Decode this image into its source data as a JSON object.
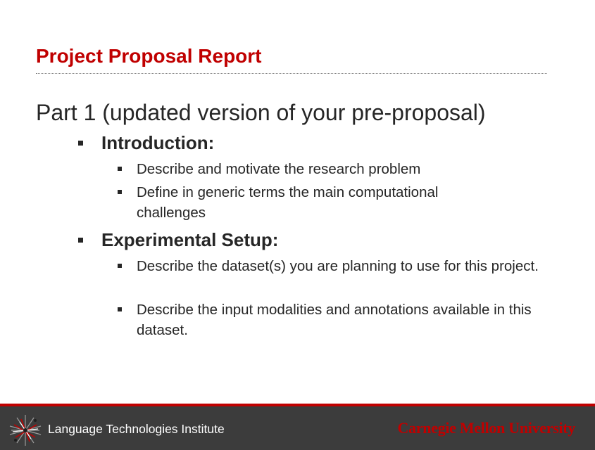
{
  "slide": {
    "title": "Project Proposal Report",
    "heading": "Part 1 (updated version of your pre-proposal)",
    "sections": [
      {
        "label": "Introduction:",
        "items": [
          "Describe and motivate the research problem",
          "Define in generic terms the main computational challenges"
        ]
      },
      {
        "label": "Experimental Setup:",
        "items": [
          "Describe the dataset(s) you are planning to use for this project.",
          "Describe the input modalities and annotations available in this dataset."
        ]
      }
    ]
  },
  "footer": {
    "institute": "Language Technologies Institute",
    "university": "Carnegie Mellon University",
    "logo_icon": "lti-network-logo-icon"
  },
  "colors": {
    "title": "#c00000",
    "text": "#262626",
    "footer_bg": "#3c3c3c",
    "footer_accent": "#c00000"
  }
}
